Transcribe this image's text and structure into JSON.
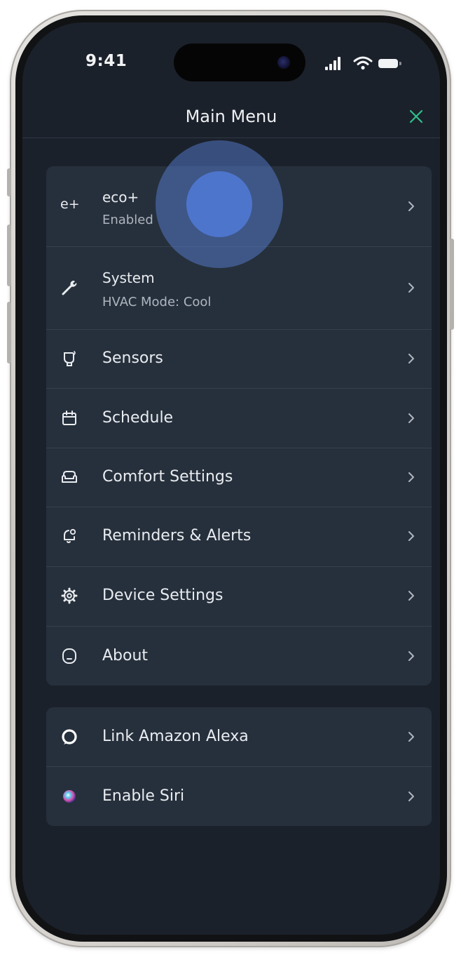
{
  "status_bar": {
    "time": "9:41",
    "icons": [
      "signal-icon",
      "wifi-icon",
      "battery-icon"
    ]
  },
  "header": {
    "title": "Main Menu",
    "close_icon": "close-icon",
    "accent_color": "#2fbf8a"
  },
  "menu_primary": [
    {
      "icon": "eco-plus-icon",
      "label": "eco+",
      "subtitle": "Enabled"
    },
    {
      "icon": "wrench-icon",
      "label": "System",
      "subtitle": "HVAC Mode: Cool"
    },
    {
      "icon": "sensor-icon",
      "label": "Sensors"
    },
    {
      "icon": "calendar-icon",
      "label": "Schedule"
    },
    {
      "icon": "sofa-icon",
      "label": "Comfort Settings"
    },
    {
      "icon": "bell-icon",
      "label": "Reminders & Alerts"
    },
    {
      "icon": "gear-icon",
      "label": "Device Settings"
    },
    {
      "icon": "thermostat-icon",
      "label": "About"
    }
  ],
  "menu_integrations": [
    {
      "icon": "alexa-icon",
      "label": "Link Amazon Alexa"
    },
    {
      "icon": "siri-icon",
      "label": "Enable Siri"
    }
  ],
  "eco_icon_text": "e+",
  "colors": {
    "background": "#1b212b",
    "card": "#26303c",
    "text": "#e9ecf0",
    "subtext": "#aeb5bf",
    "touch_indicator": "#4e75cc"
  }
}
